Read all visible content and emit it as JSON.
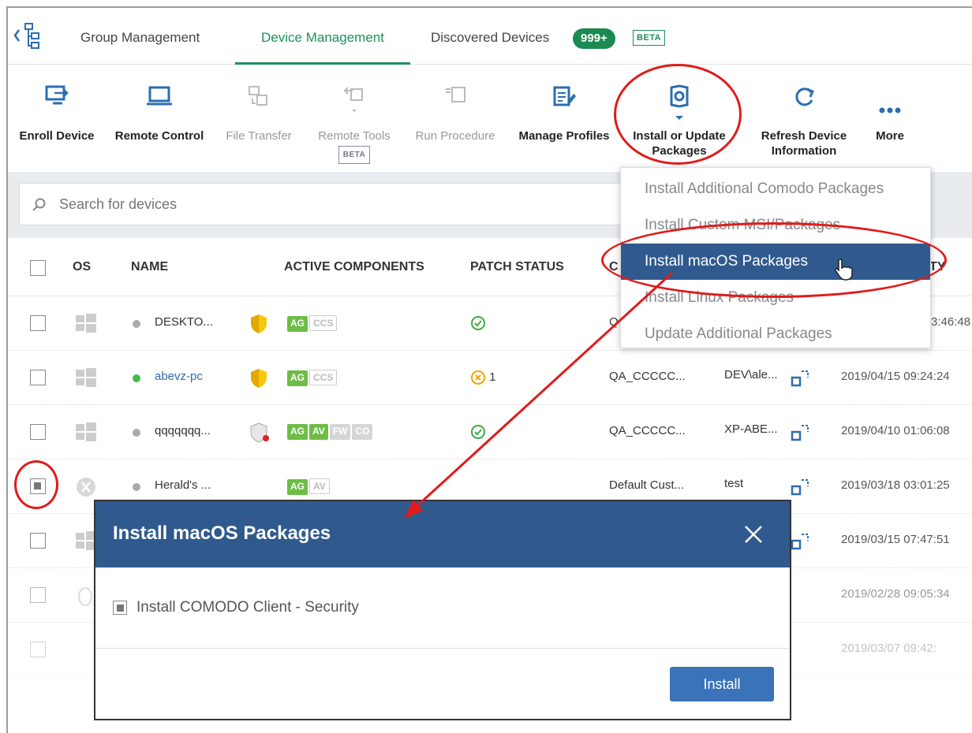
{
  "tabs": {
    "group_management": "Group Management",
    "device_management": "Device Management",
    "discovered_devices": "Discovered Devices",
    "discovered_badge": "999+",
    "beta": "BETA"
  },
  "toolbar": {
    "enroll_device": "Enroll Device",
    "remote_control": "Remote Control",
    "file_transfer": "File Transfer",
    "remote_tools": "Remote Tools",
    "remote_tools_badge": "BETA",
    "run_procedure": "Run Procedure",
    "manage_profiles": "Manage Profiles",
    "install_update_line1": "Install or Update",
    "install_update_line2": "Packages",
    "refresh_line1": "Refresh Device",
    "refresh_line2": "Information",
    "more": "More"
  },
  "search": {
    "placeholder": "Search for devices"
  },
  "table": {
    "headers": {
      "os": "OS",
      "name": "NAME",
      "active_components": "ACTIVE COMPONENTS",
      "patch_status": "PATCH STATUS",
      "customer": "C",
      "last_activity": "TY"
    },
    "rows": [
      {
        "name": "DESKTO...",
        "status": "offline",
        "components": [
          "AG",
          "CCS"
        ],
        "patch": "",
        "customer": "Q",
        "user": "",
        "date": "3:46:48"
      },
      {
        "name": "abevz-pc",
        "status": "online",
        "components": [
          "AG",
          "CCS"
        ],
        "patch": "1",
        "customer": "QA_CCCCC...",
        "user": "DEV\\ale...",
        "date": "2019/04/15 09:24:24"
      },
      {
        "name": "qqqqqqq...",
        "status": "offline",
        "components": [
          "AG",
          "AV",
          "FW",
          "CO"
        ],
        "patch": "",
        "customer": "QA_CCCCC...",
        "user": "XP-ABE...",
        "date": "2019/04/10 01:06:08"
      },
      {
        "name": "Herald's ...",
        "status": "offline",
        "components": [
          "AG",
          "AV"
        ],
        "patch": "",
        "customer": "Default Cust...",
        "user": "test",
        "date": "2019/03/18 03:01:25"
      },
      {
        "name": "",
        "status": "",
        "components": [],
        "patch": "",
        "customer": "",
        "user": "",
        "date": "2019/03/15 07:47:51"
      },
      {
        "name": "",
        "status": "",
        "components": [],
        "patch": "",
        "customer": "",
        "user": "",
        "date": "2019/02/28 09:05:34"
      },
      {
        "name": "",
        "status": "",
        "components": [],
        "patch": "",
        "customer": "",
        "user": "",
        "date": "2019/03/07 09:42:"
      }
    ]
  },
  "dropdown": {
    "items": [
      "Install Additional Comodo Packages",
      "Install Custom MSI/Packages",
      "Install macOS Packages",
      "Install Linux Packages",
      "Update Additional Packages"
    ]
  },
  "dialog": {
    "title": "Install macOS Packages",
    "option": "Install COMODO Client - Security",
    "install_button": "Install"
  },
  "colors": {
    "accent_green": "#1d8f5a",
    "dialog_blue": "#305a8e",
    "button_blue": "#3a73b8",
    "annotation_red": "#e01b1b"
  }
}
